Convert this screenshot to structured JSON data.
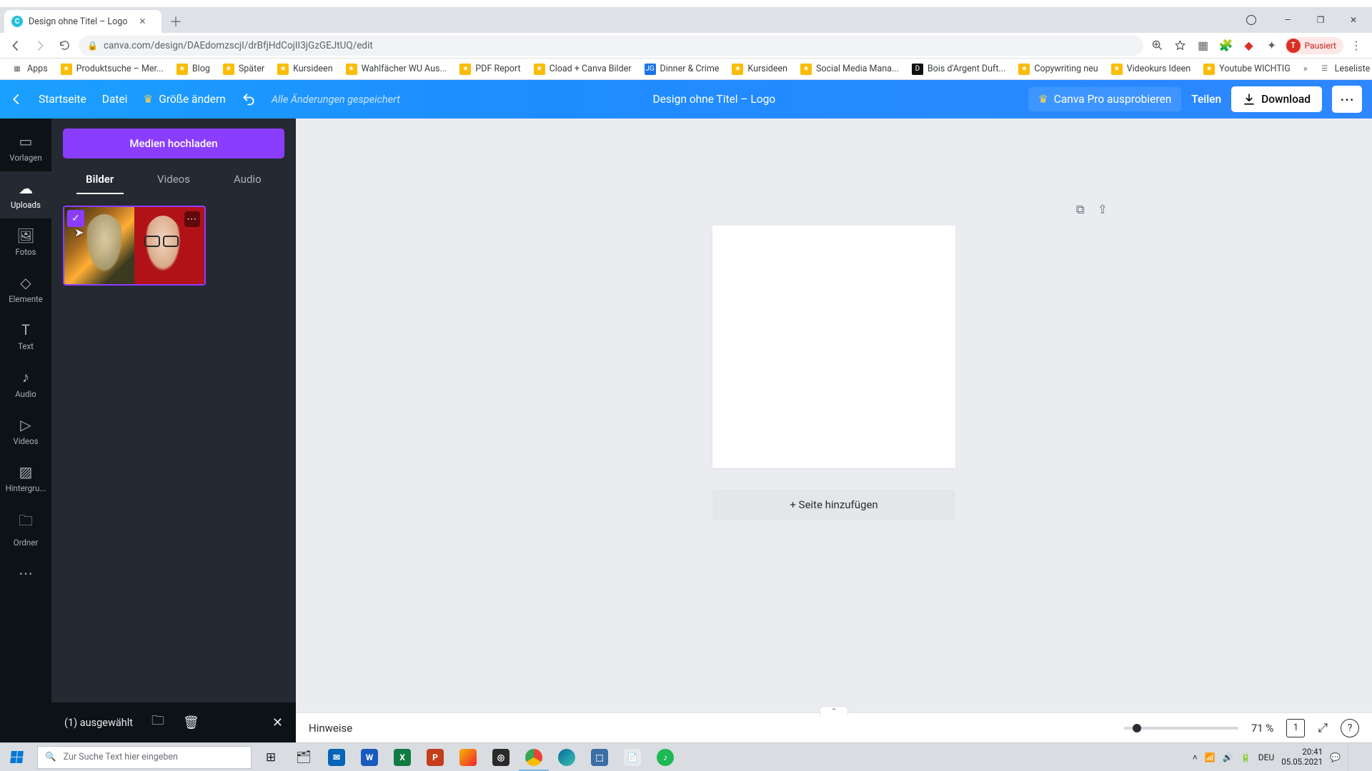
{
  "browser": {
    "tab_title": "Design ohne Titel – Logo",
    "url": "canva.com/design/DAEdomzscjI/drBfjHdCojII3jGzGEJtUQ/edit",
    "profile_badge_letter": "T",
    "profile_status": "Pausiert"
  },
  "bookmarks": {
    "apps": "Apps",
    "items": [
      "Produktsuche – Mer...",
      "Blog",
      "Später",
      "Kursideen",
      "Wahlfächer WU Aus...",
      "PDF Report",
      "Cload + Canva Bilder",
      "Dinner & Crime",
      "Kursideen",
      "Social Media Mana...",
      "Bois d'Argent Duft...",
      "Copywriting neu",
      "Videokurs Ideen",
      "Youtube WICHTIG"
    ],
    "reading_list": "Leseliste"
  },
  "canva_top": {
    "home": "Startseite",
    "file": "Datei",
    "resize": "Größe ändern",
    "saved": "Alle Änderungen gespeichert",
    "title": "Design ohne Titel – Logo",
    "try_pro": "Canva Pro ausprobieren",
    "share": "Teilen",
    "download": "Download"
  },
  "rail": {
    "templates": "Vorlagen",
    "uploads": "Uploads",
    "photos": "Fotos",
    "elements": "Elemente",
    "text": "Text",
    "audio": "Audio",
    "videos": "Videos",
    "background": "Hintergru...",
    "folders": "Ordner"
  },
  "panel": {
    "upload_btn": "Medien hochladen",
    "tab_images": "Bilder",
    "tab_videos": "Videos",
    "tab_audio": "Audio",
    "selected_count": "(1) ausgewählt"
  },
  "canvas": {
    "add_page": "+ Seite hinzufügen",
    "hints": "Hinweise",
    "zoom_label": "71 %",
    "page_indicator": "1"
  },
  "taskbar": {
    "search_placeholder": "Zur Suche Text hier eingeben",
    "lang": "DEU",
    "time": "20:41",
    "date": "05.05.2021"
  }
}
